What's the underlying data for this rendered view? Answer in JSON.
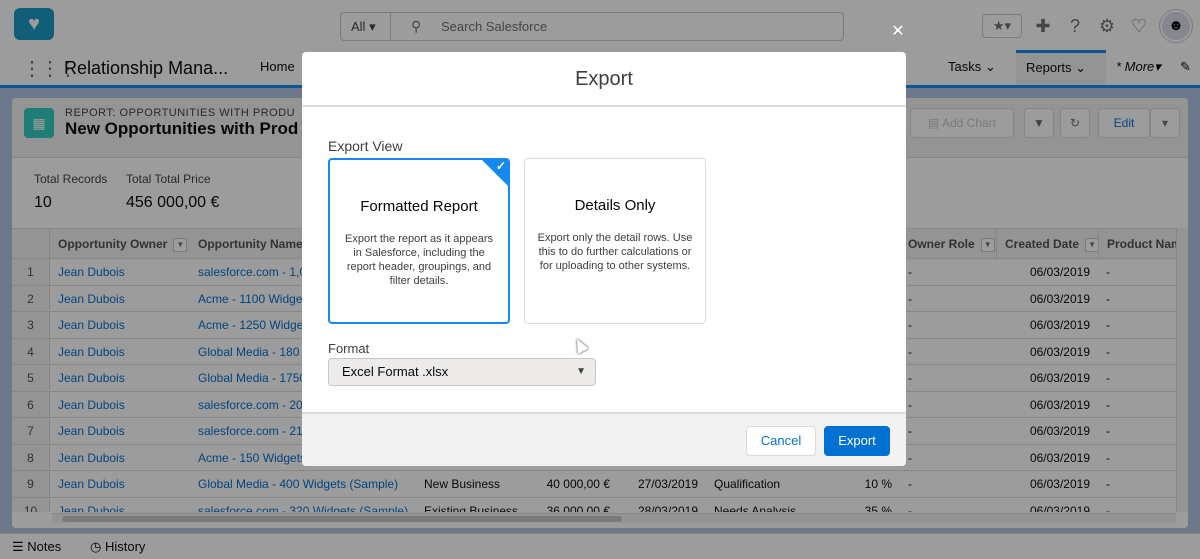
{
  "topbar": {
    "search_scope": "All",
    "search_placeholder": "Search Salesforce"
  },
  "navbar": {
    "app_name": "Relationship Mana...",
    "items": [
      {
        "label": "Home"
      },
      {
        "label": "Tasks"
      },
      {
        "label": "Reports"
      },
      {
        "label": "* More"
      }
    ]
  },
  "report": {
    "eyebrow": "REPORT: OPPORTUNITIES WITH PRODU",
    "title": "New Opportunities with Prod",
    "add_chart_label": "Add Chart",
    "edit_label": "Edit",
    "total_records_label": "Total Records",
    "total_records_value": "10",
    "total_price_label": "Total Total Price",
    "total_price_value": "456 000,00 €"
  },
  "grid": {
    "headers": [
      "Opportunity Owner",
      "Opportunity Name",
      "Owner Role",
      "Created Date",
      "Product Nam"
    ],
    "rows": [
      {
        "n": "1",
        "owner": "Jean Dubois",
        "name": "salesforce.com - 1,0",
        "type": "",
        "amount": "",
        "close": "",
        "stage": "",
        "prob": "",
        "role": "-",
        "created": "06/03/2019",
        "product": "-"
      },
      {
        "n": "2",
        "owner": "Jean Dubois",
        "name": "Acme - 1100 Widget",
        "type": "",
        "amount": "",
        "close": "",
        "stage": "",
        "prob": "",
        "role": "-",
        "created": "06/03/2019",
        "product": "-"
      },
      {
        "n": "3",
        "owner": "Jean Dubois",
        "name": "Acme - 1250 Widget",
        "type": "",
        "amount": "",
        "close": "",
        "stage": "",
        "prob": "",
        "role": "-",
        "created": "06/03/2019",
        "product": "-"
      },
      {
        "n": "4",
        "owner": "Jean Dubois",
        "name": "Global Media - 180 W",
        "type": "",
        "amount": "",
        "close": "",
        "stage": "",
        "prob": "",
        "role": "-",
        "created": "06/03/2019",
        "product": "-"
      },
      {
        "n": "5",
        "owner": "Jean Dubois",
        "name": "Global Media - 1750",
        "type": "",
        "amount": "",
        "close": "",
        "stage": "",
        "prob": "",
        "role": "-",
        "created": "06/03/2019",
        "product": "-"
      },
      {
        "n": "6",
        "owner": "Jean Dubois",
        "name": "salesforce.com - 200",
        "type": "",
        "amount": "",
        "close": "",
        "stage": "",
        "prob": "",
        "role": "-",
        "created": "06/03/2019",
        "product": "-"
      },
      {
        "n": "7",
        "owner": "Jean Dubois",
        "name": "salesforce.com - 210",
        "type": "",
        "amount": "",
        "close": "",
        "stage": "",
        "prob": "",
        "role": "-",
        "created": "06/03/2019",
        "product": "-"
      },
      {
        "n": "8",
        "owner": "Jean Dubois",
        "name": "Acme - 150 Widgets",
        "type": "",
        "amount": "",
        "close": "",
        "stage": "",
        "prob": "",
        "role": "-",
        "created": "06/03/2019",
        "product": "-"
      },
      {
        "n": "9",
        "owner": "Jean Dubois",
        "name": "Global Media - 400 Widgets (Sample)",
        "type": "New Business",
        "amount": "40 000,00 €",
        "close": "27/03/2019",
        "stage": "Qualification",
        "prob": "10 %",
        "role": "-",
        "created": "06/03/2019",
        "product": "-"
      },
      {
        "n": "10",
        "owner": "Jean Dubois",
        "name": "salesforce.com - 320 Widgets (Sample)",
        "type": "Existing Business",
        "amount": "36 000,00 €",
        "close": "28/03/2019",
        "stage": "Needs Analysis",
        "prob": "35 %",
        "role": "-",
        "created": "06/03/2019",
        "product": "-"
      }
    ]
  },
  "utility": {
    "notes_label": "Notes",
    "history_label": "History"
  },
  "modal": {
    "title": "Export",
    "section_label": "Export View",
    "options": [
      {
        "title": "Formatted Report",
        "description": "Export the report as it appears in Salesforce, including the report header, groupings, and filter details.",
        "selected": true
      },
      {
        "title": "Details Only",
        "description": "Export only the detail rows. Use this to do further calculations or for uploading to other systems.",
        "selected": false
      }
    ],
    "format_label": "Format",
    "format_value": "Excel Format .xlsx",
    "cancel_label": "Cancel",
    "export_label": "Export"
  },
  "colors": {
    "brand": "#0070d2",
    "accent": "#1589ee",
    "link": "#006dcc"
  }
}
